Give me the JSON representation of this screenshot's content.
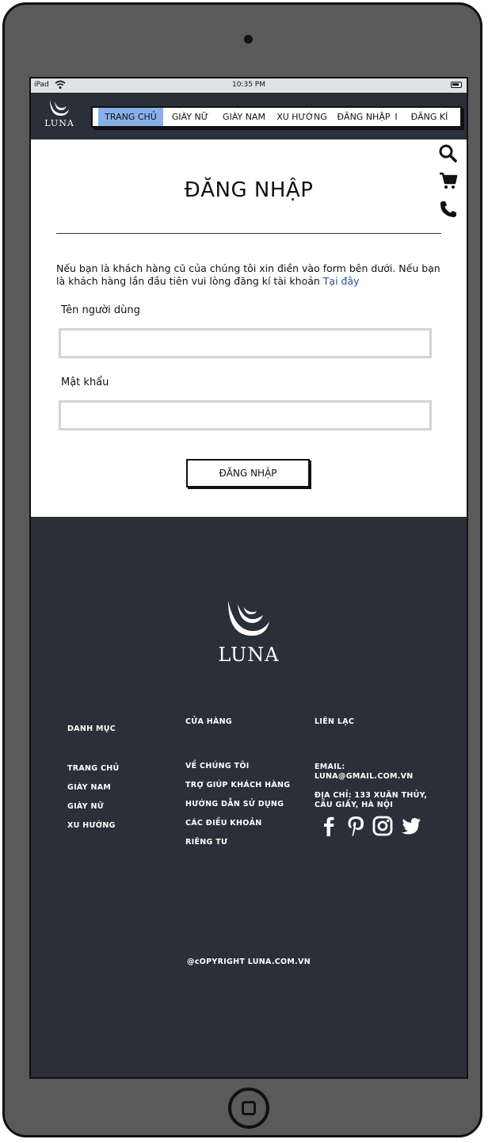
{
  "status_bar": {
    "carrier": "iPad",
    "time": "10:35 PM"
  },
  "brand": {
    "name": "LUNA"
  },
  "nav": {
    "items": [
      "TRANG CHỦ",
      "GIÀY NỮ",
      "GIÀY NAM",
      "XU HƯỚNG",
      "ĐĂNG NHẬP",
      "ĐĂNG KÍ"
    ],
    "active_index": 0,
    "separator": "I"
  },
  "header_icons": [
    "search-icon",
    "cart-icon",
    "phone-icon"
  ],
  "login": {
    "title": "ĐĂNG NHẬP",
    "intro": "Nếu bạn là khách hàng cũ của chúng tôi xin điền vào form bên dưới. Nếu bạn là khách hàng lần đầu tiên vui lòng đăng kí tài khoản",
    "intro_link": "Tại đây",
    "username_label": "Tên người dùng",
    "username_value": "",
    "password_label": "Mật khẩu",
    "password_value": "",
    "submit_label": "ĐĂNG NHẬP"
  },
  "footer": {
    "columns": {
      "catalog": {
        "title": "DANH MỤC",
        "items": [
          "TRANG CHỦ",
          "GIÀY NAM",
          "GIÀY NỮ",
          "XU HƯỚNG"
        ]
      },
      "store": {
        "title": "CỬA HÀNG",
        "items": [
          "VỀ CHÚNG TÔI",
          "TRỢ GIÚP KHÁCH HÀNG",
          "HƯỚNG DẪN SỬ DỤNG",
          "CÁC ĐIỀU KHOẢN",
          "RIÊNG TƯ"
        ]
      },
      "contact": {
        "title": "LIÊN LẠC",
        "email": "EMAIL: LUNA@GMAIL.COM.VN",
        "address": "ĐỊA CHỈ: 133 XUÂN THỦY, CẦU GIẤY, HÀ NỘI"
      }
    },
    "social_icons": [
      "facebook-icon",
      "pinterest-icon",
      "instagram-icon",
      "twitter-icon"
    ],
    "copyright": "@cOPYRIGHT LUNA.COM.VN"
  },
  "colors": {
    "dark_bg": "#2b2f39",
    "nav_active": "#8ab0ea",
    "link": "#1f4e99",
    "frame": "#5a5a5a"
  }
}
